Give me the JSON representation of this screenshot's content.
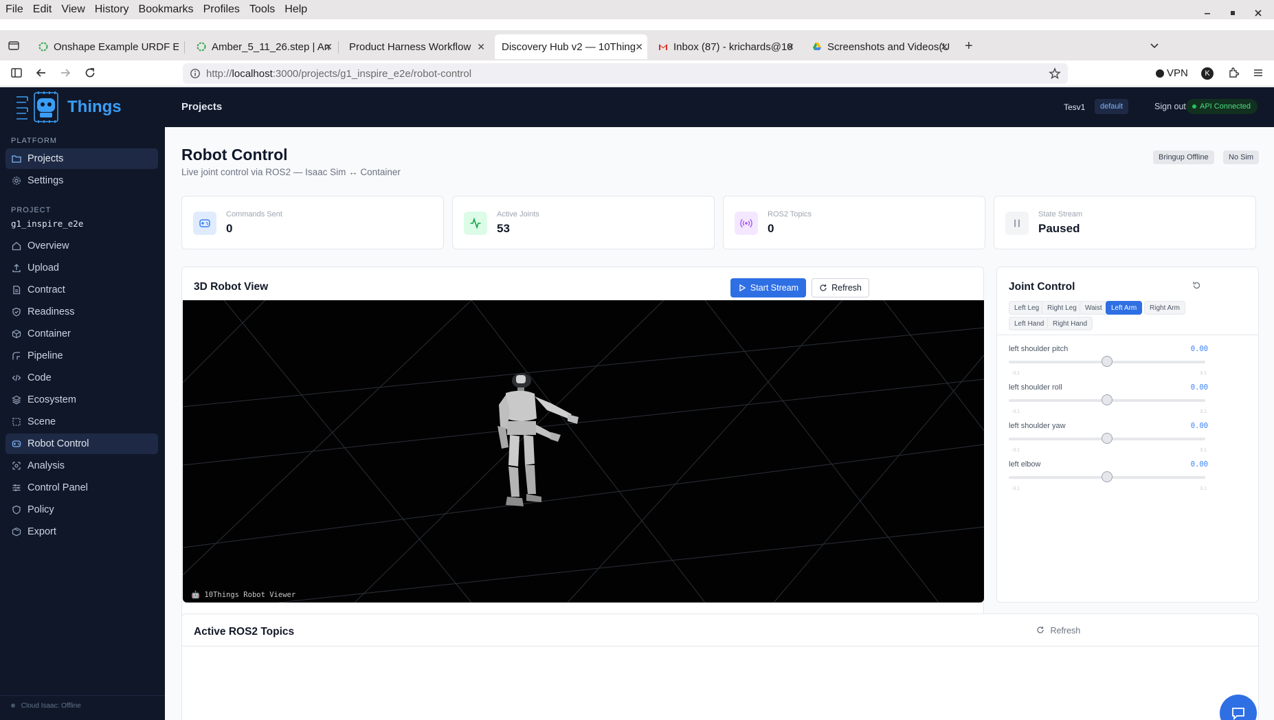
{
  "browser": {
    "menu": [
      "File",
      "Edit",
      "View",
      "History",
      "Bookmarks",
      "Profiles",
      "Tools",
      "Help"
    ],
    "tabs": [
      {
        "title": "Onshape Example URDF E"
      },
      {
        "title": "Amber_5_11_26.step | An"
      },
      {
        "title": "Product Harness Workflow"
      },
      {
        "title": "Discovery Hub v2 — 10Thing"
      },
      {
        "title": "Inbox (87) - krichards@10"
      },
      {
        "title": "Screenshots and Videos(U"
      }
    ],
    "url_prefix": "http://",
    "url_host": "localhost",
    "url_rest": ":3000/projects/g1_inspire_e2e/robot-control",
    "vpn_label": "VPN",
    "profile_initial": "K"
  },
  "brand": {
    "name": "Things"
  },
  "sidebar": {
    "platform_label": "Platform",
    "platform_items": [
      {
        "label": "Projects",
        "icon": "folder-icon"
      },
      {
        "label": "Settings",
        "icon": "gear-icon"
      }
    ],
    "project_label": "Project",
    "project_name": "g1_inspire_e2e",
    "project_items": [
      {
        "label": "Overview",
        "icon": "home-icon"
      },
      {
        "label": "Upload",
        "icon": "upload-icon"
      },
      {
        "label": "Contract",
        "icon": "document-icon"
      },
      {
        "label": "Readiness",
        "icon": "shield-check-icon"
      },
      {
        "label": "Container",
        "icon": "box-icon"
      },
      {
        "label": "Pipeline",
        "icon": "pipeline-icon"
      },
      {
        "label": "Code",
        "icon": "code-icon"
      },
      {
        "label": "Ecosystem",
        "icon": "layers-icon"
      },
      {
        "label": "Scene",
        "icon": "scene-icon"
      },
      {
        "label": "Robot Control",
        "icon": "gamepad-icon"
      },
      {
        "label": "Analysis",
        "icon": "analysis-icon"
      },
      {
        "label": "Control Panel",
        "icon": "sliders-icon"
      },
      {
        "label": "Policy",
        "icon": "shield-icon"
      },
      {
        "label": "Export",
        "icon": "package-icon"
      }
    ],
    "footer_status": "Cloud Isaac: Offline"
  },
  "topbar": {
    "breadcrumb": "Projects",
    "user": "Tesv1",
    "workspace": "default",
    "sign_out": "Sign out",
    "api_status": "API Connected"
  },
  "page": {
    "title": "Robot Control",
    "subtitle": "Live joint control via ROS2 — Isaac Sim ↔ Container",
    "badges": [
      "Bringup Offline",
      "No Sim"
    ]
  },
  "stats": [
    {
      "label": "Commands Sent",
      "value": "0",
      "icon": "gamepad-icon"
    },
    {
      "label": "Active Joints",
      "value": "53",
      "icon": "activity-icon"
    },
    {
      "label": "ROS2 Topics",
      "value": "0",
      "icon": "broadcast-icon"
    },
    {
      "label": "State Stream",
      "value": "Paused",
      "icon": "pause-icon"
    }
  ],
  "viewer": {
    "title": "3D Robot View",
    "start_stream": "Start Stream",
    "refresh": "Refresh",
    "viewer_label": "10Things Robot Viewer"
  },
  "joint_control": {
    "title": "Joint Control",
    "groups": [
      "Left Leg",
      "Right Leg",
      "Waist",
      "Left Arm",
      "Right Arm",
      "Left Hand",
      "Right Hand"
    ],
    "active_group": "Left Arm",
    "joints": [
      {
        "name": "left shoulder pitch",
        "value": "0.00",
        "min": "-3.1",
        "max": "3.1",
        "level": 0.5
      },
      {
        "name": "left shoulder roll",
        "value": "0.00",
        "min": "-3.1",
        "max": "3.1",
        "level": 0.5
      },
      {
        "name": "left shoulder yaw",
        "value": "0.00",
        "min": "-3.1",
        "max": "3.1",
        "level": 0.5
      },
      {
        "name": "left elbow",
        "value": "0.00",
        "min": "-3.1",
        "max": "3.1",
        "level": 0.5
      }
    ]
  },
  "topics": {
    "title": "Active ROS2 Topics",
    "refresh": "Refresh"
  },
  "colors": {
    "sidebar_bg": "#0f1729",
    "accent": "#2f6fe4",
    "brand": "#3b9ef5",
    "api_ok": "#22c55e"
  }
}
